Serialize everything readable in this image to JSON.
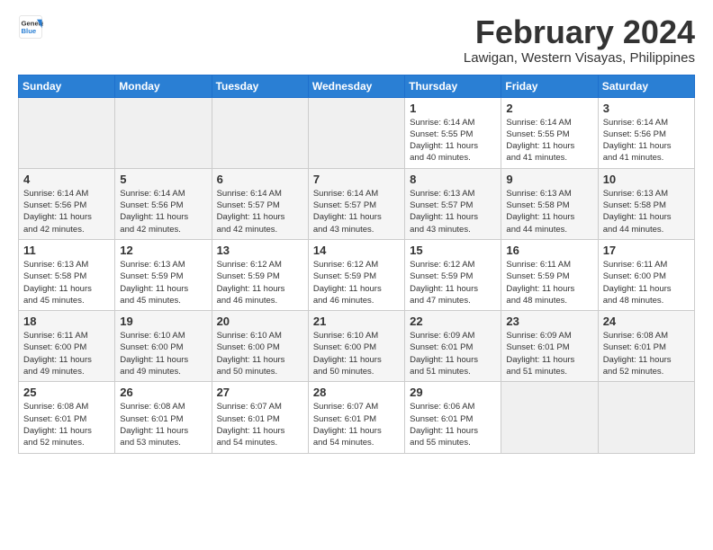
{
  "header": {
    "logo_line1": "General",
    "logo_line2": "Blue",
    "month_year": "February 2024",
    "location": "Lawigan, Western Visayas, Philippines"
  },
  "weekdays": [
    "Sunday",
    "Monday",
    "Tuesday",
    "Wednesday",
    "Thursday",
    "Friday",
    "Saturday"
  ],
  "weeks": [
    {
      "days": [
        {
          "num": "",
          "info": ""
        },
        {
          "num": "",
          "info": ""
        },
        {
          "num": "",
          "info": ""
        },
        {
          "num": "",
          "info": ""
        },
        {
          "num": "1",
          "info": "Sunrise: 6:14 AM\nSunset: 5:55 PM\nDaylight: 11 hours\nand 40 minutes."
        },
        {
          "num": "2",
          "info": "Sunrise: 6:14 AM\nSunset: 5:55 PM\nDaylight: 11 hours\nand 41 minutes."
        },
        {
          "num": "3",
          "info": "Sunrise: 6:14 AM\nSunset: 5:56 PM\nDaylight: 11 hours\nand 41 minutes."
        }
      ]
    },
    {
      "days": [
        {
          "num": "4",
          "info": "Sunrise: 6:14 AM\nSunset: 5:56 PM\nDaylight: 11 hours\nand 42 minutes."
        },
        {
          "num": "5",
          "info": "Sunrise: 6:14 AM\nSunset: 5:56 PM\nDaylight: 11 hours\nand 42 minutes."
        },
        {
          "num": "6",
          "info": "Sunrise: 6:14 AM\nSunset: 5:57 PM\nDaylight: 11 hours\nand 42 minutes."
        },
        {
          "num": "7",
          "info": "Sunrise: 6:14 AM\nSunset: 5:57 PM\nDaylight: 11 hours\nand 43 minutes."
        },
        {
          "num": "8",
          "info": "Sunrise: 6:13 AM\nSunset: 5:57 PM\nDaylight: 11 hours\nand 43 minutes."
        },
        {
          "num": "9",
          "info": "Sunrise: 6:13 AM\nSunset: 5:58 PM\nDaylight: 11 hours\nand 44 minutes."
        },
        {
          "num": "10",
          "info": "Sunrise: 6:13 AM\nSunset: 5:58 PM\nDaylight: 11 hours\nand 44 minutes."
        }
      ]
    },
    {
      "days": [
        {
          "num": "11",
          "info": "Sunrise: 6:13 AM\nSunset: 5:58 PM\nDaylight: 11 hours\nand 45 minutes."
        },
        {
          "num": "12",
          "info": "Sunrise: 6:13 AM\nSunset: 5:59 PM\nDaylight: 11 hours\nand 45 minutes."
        },
        {
          "num": "13",
          "info": "Sunrise: 6:12 AM\nSunset: 5:59 PM\nDaylight: 11 hours\nand 46 minutes."
        },
        {
          "num": "14",
          "info": "Sunrise: 6:12 AM\nSunset: 5:59 PM\nDaylight: 11 hours\nand 46 minutes."
        },
        {
          "num": "15",
          "info": "Sunrise: 6:12 AM\nSunset: 5:59 PM\nDaylight: 11 hours\nand 47 minutes."
        },
        {
          "num": "16",
          "info": "Sunrise: 6:11 AM\nSunset: 5:59 PM\nDaylight: 11 hours\nand 48 minutes."
        },
        {
          "num": "17",
          "info": "Sunrise: 6:11 AM\nSunset: 6:00 PM\nDaylight: 11 hours\nand 48 minutes."
        }
      ]
    },
    {
      "days": [
        {
          "num": "18",
          "info": "Sunrise: 6:11 AM\nSunset: 6:00 PM\nDaylight: 11 hours\nand 49 minutes."
        },
        {
          "num": "19",
          "info": "Sunrise: 6:10 AM\nSunset: 6:00 PM\nDaylight: 11 hours\nand 49 minutes."
        },
        {
          "num": "20",
          "info": "Sunrise: 6:10 AM\nSunset: 6:00 PM\nDaylight: 11 hours\nand 50 minutes."
        },
        {
          "num": "21",
          "info": "Sunrise: 6:10 AM\nSunset: 6:00 PM\nDaylight: 11 hours\nand 50 minutes."
        },
        {
          "num": "22",
          "info": "Sunrise: 6:09 AM\nSunset: 6:01 PM\nDaylight: 11 hours\nand 51 minutes."
        },
        {
          "num": "23",
          "info": "Sunrise: 6:09 AM\nSunset: 6:01 PM\nDaylight: 11 hours\nand 51 minutes."
        },
        {
          "num": "24",
          "info": "Sunrise: 6:08 AM\nSunset: 6:01 PM\nDaylight: 11 hours\nand 52 minutes."
        }
      ]
    },
    {
      "days": [
        {
          "num": "25",
          "info": "Sunrise: 6:08 AM\nSunset: 6:01 PM\nDaylight: 11 hours\nand 52 minutes."
        },
        {
          "num": "26",
          "info": "Sunrise: 6:08 AM\nSunset: 6:01 PM\nDaylight: 11 hours\nand 53 minutes."
        },
        {
          "num": "27",
          "info": "Sunrise: 6:07 AM\nSunset: 6:01 PM\nDaylight: 11 hours\nand 54 minutes."
        },
        {
          "num": "28",
          "info": "Sunrise: 6:07 AM\nSunset: 6:01 PM\nDaylight: 11 hours\nand 54 minutes."
        },
        {
          "num": "29",
          "info": "Sunrise: 6:06 AM\nSunset: 6:01 PM\nDaylight: 11 hours\nand 55 minutes."
        },
        {
          "num": "",
          "info": ""
        },
        {
          "num": "",
          "info": ""
        }
      ]
    }
  ]
}
